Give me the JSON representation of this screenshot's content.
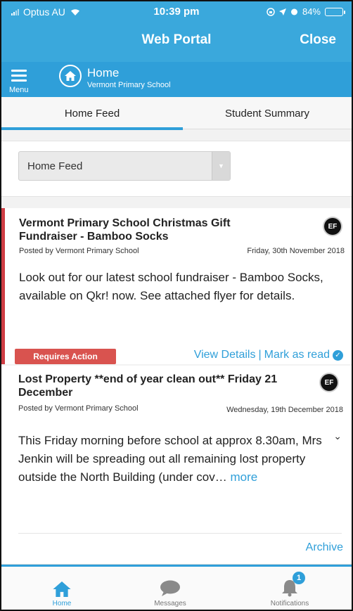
{
  "status_bar": {
    "carrier": "Optus AU",
    "time": "10:39 pm",
    "battery": "84%",
    "battery_level": 0.84
  },
  "titlebar": {
    "title": "Web Portal",
    "close_label": "Close"
  },
  "header": {
    "menu_label": "Menu",
    "title": "Home",
    "subtitle": "Vermont Primary School"
  },
  "tabs": [
    {
      "label": "Home Feed",
      "active": true
    },
    {
      "label": "Student Summary",
      "active": false
    }
  ],
  "feed_select": {
    "value": "Home Feed"
  },
  "posts": [
    {
      "title": "Vermont Primary School Christmas Gift Fundraiser - Bamboo Socks",
      "badge": "EF",
      "posted_by": "Posted by Vermont Primary School",
      "date": "Friday, 30th November 2018",
      "body": "Look out for our latest school fundraiser - Bamboo Socks, available on Qkr! now.   See attached flyer for details.",
      "requires_action": "Requires Action",
      "view_details": "View Details",
      "separator": "|",
      "mark_read": "Mark as read"
    },
    {
      "title": "Lost Property **end of year clean out** Friday 21 December",
      "badge": "EF",
      "posted_by": "Posted by Vermont Primary School",
      "date": "Wednesday, 19th December 2018",
      "body": "This Friday morning before school at approx 8.30am, Mrs Jenkin will be spreading out all remaining lost property outside the North Building (under cov…",
      "more": "more",
      "archive": "Archive"
    }
  ],
  "bottom_nav": [
    {
      "label": "Home",
      "icon": "home-icon",
      "active": true
    },
    {
      "label": "Messages",
      "icon": "chat-bubble-icon",
      "active": false
    },
    {
      "label": "Notifications",
      "icon": "bell-icon",
      "active": false,
      "count": "1"
    }
  ],
  "colors": {
    "primary": "#2f9fd9",
    "alert": "#cf3d44"
  }
}
